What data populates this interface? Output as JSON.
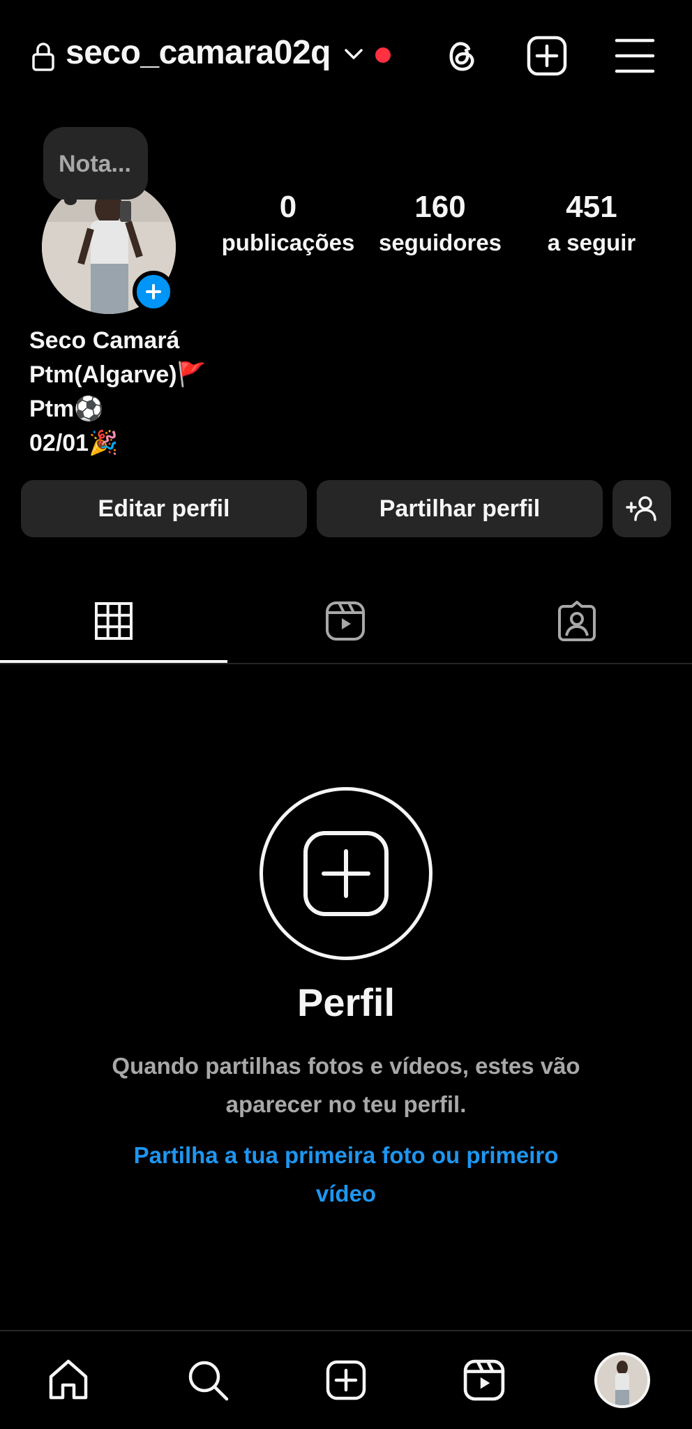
{
  "header": {
    "username": "seco_camara02q",
    "icons": [
      "lock-icon",
      "chevron-down-icon",
      "threads-icon",
      "create-post-icon",
      "hamburger-menu-icon"
    ]
  },
  "note": {
    "placeholder": "Nota..."
  },
  "stats": {
    "posts": {
      "value": "0",
      "label": "publicações"
    },
    "followers": {
      "value": "160",
      "label": "seguidores"
    },
    "following": {
      "value": "451",
      "label": "a seguir"
    }
  },
  "bio": {
    "name": "Seco Camará",
    "line1": "Ptm(Algarve)🚩",
    "line2": "Ptm⚽",
    "line3": "02/01🎉"
  },
  "buttons": {
    "edit": "Editar perfil",
    "share": "Partilhar perfil"
  },
  "tabs": [
    "grid-tab",
    "reels-tab",
    "tagged-tab"
  ],
  "empty_state": {
    "title": "Perfil",
    "description": "Quando partilhas fotos e vídeos, estes vão aparecer no teu perfil.",
    "link": "Partilha a tua primeira foto ou primeiro vídeo"
  },
  "nav": [
    "home",
    "search",
    "create",
    "reels",
    "profile"
  ],
  "colors": {
    "background": "#000000",
    "accent": "#0095f6",
    "link": "#1e96f0",
    "notification": "#ff3040",
    "surface": "#262626"
  }
}
